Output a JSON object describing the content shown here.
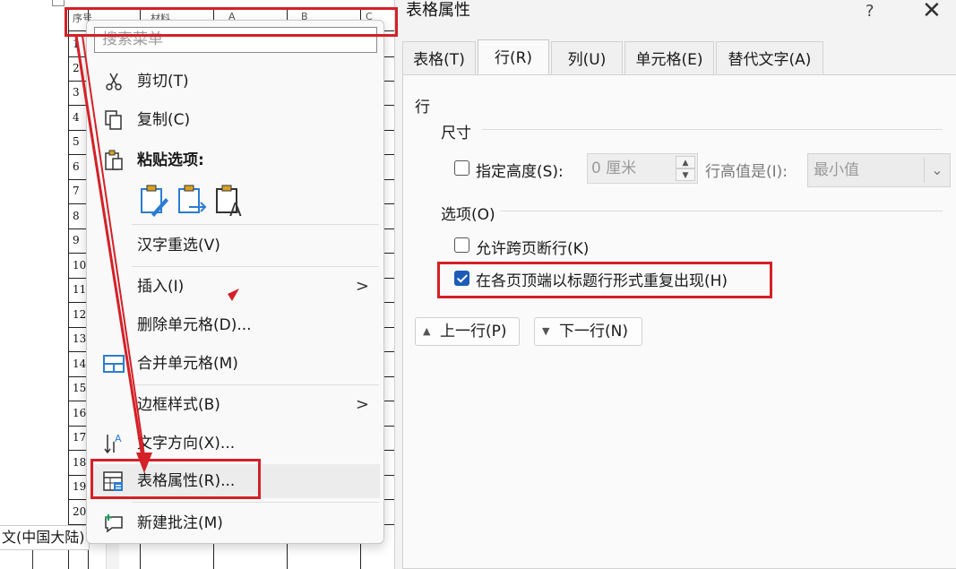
{
  "document": {
    "row_numbers": [
      "1",
      "2",
      "3",
      "4",
      "5",
      "6",
      "7",
      "8",
      "9",
      "10",
      "11",
      "12",
      "13",
      "14",
      "15",
      "16",
      "17",
      "18",
      "19",
      "20"
    ],
    "header_cells": [
      "序号",
      "材料",
      "A",
      "B",
      "C"
    ],
    "language_status": "文(中国大陆)"
  },
  "context_menu": {
    "search_placeholder": "搜索菜单",
    "cut": "剪切(T)",
    "copy": "复制(C)",
    "paste_options": "粘贴选项:",
    "reconvert": "汉字重选(V)",
    "insert": "插入(I)",
    "delete_cells": "删除单元格(D)...",
    "merge_cells": "合并单元格(M)",
    "border_styles": "边框样式(B)",
    "text_direction": "文字方向(X)...",
    "table_properties": "表格属性(R)...",
    "new_comment": "新建批注(M)",
    "submenu_arrow": ">"
  },
  "dialog": {
    "title": "表格属性",
    "help": "?",
    "close": "✕",
    "tabs": [
      "表格(T)",
      "行(R)",
      "列(U)",
      "单元格(E)",
      "替代文字(A)"
    ],
    "active_tab": "行(R)",
    "section_row": "行",
    "group_size": "尺寸",
    "specify_height_label": "指定高度(S):",
    "specify_height_checked": false,
    "height_value": "0 厘米",
    "row_height_is_label": "行高值是(I):",
    "row_height_is_value": "最小值",
    "group_options": "选项(O)",
    "allow_break_label": "允许跨页断行(K)",
    "allow_break_checked": false,
    "repeat_header_label": "在各页顶端以标题行形式重复出现(H)",
    "repeat_header_checked": true,
    "prev_row": "上一行(P)",
    "next_row": "下一行(N)"
  },
  "colors": {
    "annotation_red": "#d42027",
    "checkbox_blue": "#1e5bb8"
  }
}
